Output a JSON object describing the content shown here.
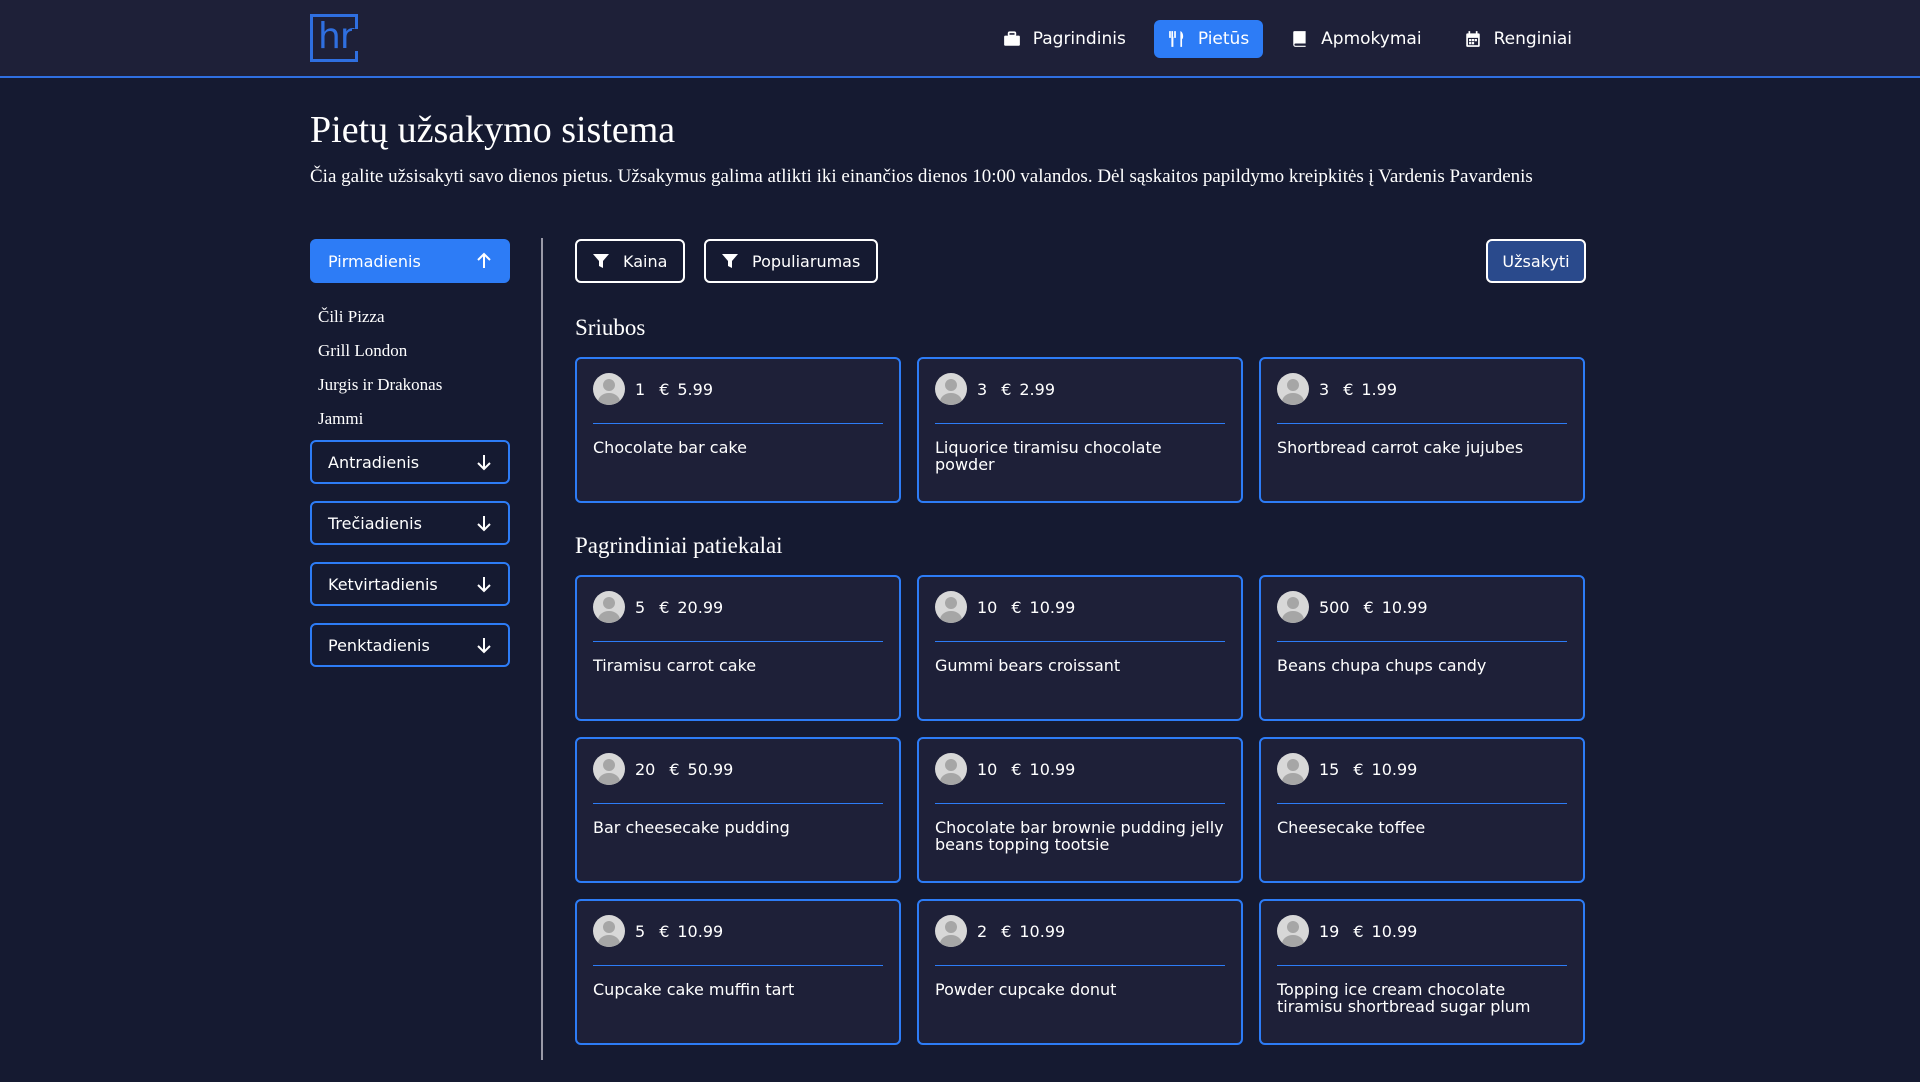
{
  "nav": [
    {
      "label": "Pagrindinis",
      "icon": "briefcase-icon",
      "active": false
    },
    {
      "label": "Pietūs",
      "icon": "utensils-icon",
      "active": true
    },
    {
      "label": "Apmokymai",
      "icon": "book-icon",
      "active": false
    },
    {
      "label": "Renginiai",
      "icon": "calendar-icon",
      "active": false
    }
  ],
  "page": {
    "title": "Pietų užsakymo sistema",
    "subtitle": "Čia galite užsisakyti savo dienos pietus. Užsakymus galima atlikti iki einančios dienos 10:00 valandos. Dėl sąskaitos papildymo kreipkitės į Vardenis Pavardenis"
  },
  "days": [
    {
      "label": "Pirmadienis",
      "expanded": true
    },
    {
      "label": "Antradienis",
      "expanded": false
    },
    {
      "label": "Trečiadienis",
      "expanded": false
    },
    {
      "label": "Ketvirtadienis",
      "expanded": false
    },
    {
      "label": "Penktadienis",
      "expanded": false
    }
  ],
  "restaurants": [
    "Čili Pizza",
    "Grill London",
    "Jurgis ir Drakonas",
    "Jammi"
  ],
  "filters": {
    "price": "Kaina",
    "popularity": "Populiarumas"
  },
  "order_button": "Užsakyti",
  "sections": [
    {
      "title": "Sriubos",
      "items": [
        {
          "count": "1",
          "currency": "€",
          "price": "5.99",
          "name": "Chocolate bar cake"
        },
        {
          "count": "3",
          "currency": "€",
          "price": "2.99",
          "name": "Liquorice tiramisu chocolate powder"
        },
        {
          "count": "3",
          "currency": "€",
          "price": "1.99",
          "name": "Shortbread carrot cake jujubes"
        }
      ]
    },
    {
      "title": "Pagrindiniai patiekalai",
      "items": [
        {
          "count": "5",
          "currency": "€",
          "price": "20.99",
          "name": "Tiramisu carrot cake"
        },
        {
          "count": "10",
          "currency": "€",
          "price": "10.99",
          "name": "Gummi bears croissant"
        },
        {
          "count": "500",
          "currency": "€",
          "price": "10.99",
          "name": "Beans chupa chups candy"
        },
        {
          "count": "20",
          "currency": "€",
          "price": "50.99",
          "name": "Bar cheesecake pudding"
        },
        {
          "count": "10",
          "currency": "€",
          "price": "10.99",
          "name": "Chocolate bar brownie pudding jelly beans topping tootsie"
        },
        {
          "count": "15",
          "currency": "€",
          "price": "10.99",
          "name": "Cheesecake toffee"
        },
        {
          "count": "5",
          "currency": "€",
          "price": "10.99",
          "name": "Cupcake cake muffin tart"
        },
        {
          "count": "2",
          "currency": "€",
          "price": "10.99",
          "name": "Powder cupcake donut"
        },
        {
          "count": "19",
          "currency": "€",
          "price": "10.99",
          "name": "Topping ice cream chocolate tiramisu shortbread sugar plum"
        }
      ]
    }
  ]
}
